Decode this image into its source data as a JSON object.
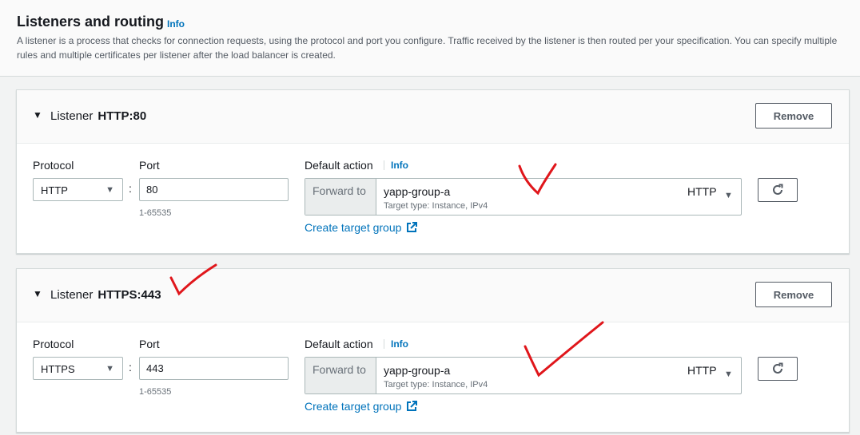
{
  "section": {
    "title": "Listeners and routing",
    "info": "Info",
    "description": "A listener is a process that checks for connection requests, using the protocol and port you configure. Traffic received by the listener is then routed per your specification. You can specify multiple rules and multiple certificates per listener after the load balancer is created."
  },
  "listeners": [
    {
      "prefix": "Listener",
      "name": "HTTP:80",
      "remove_label": "Remove",
      "protocol_label": "Protocol",
      "protocol_value": "HTTP",
      "port_label": "Port",
      "port_value": "80",
      "port_hint": "1-65535",
      "default_action_label": "Default action",
      "info": "Info",
      "forward_label": "Forward to",
      "target_group": "yapp-group-a",
      "target_type": "Target type: Instance, IPv4",
      "target_protocol": "HTTP",
      "create_target_group": "Create target group"
    },
    {
      "prefix": "Listener",
      "name": "HTTPS:443",
      "remove_label": "Remove",
      "protocol_label": "Protocol",
      "protocol_value": "HTTPS",
      "port_label": "Port",
      "port_value": "443",
      "port_hint": "1-65535",
      "default_action_label": "Default action",
      "info": "Info",
      "forward_label": "Forward to",
      "target_group": "yapp-group-a",
      "target_type": "Target type: Instance, IPv4",
      "target_protocol": "HTTP",
      "create_target_group": "Create target group"
    }
  ],
  "icons": {
    "caret": "caret-down-icon",
    "select_arrow": "triangle-down-icon",
    "refresh": "refresh-icon",
    "external": "external-link-icon",
    "annotation": "red-checkmark-annotation"
  },
  "colors": {
    "link": "#0073bb",
    "annotation": "#e0161b",
    "border": "#aab7b8"
  }
}
